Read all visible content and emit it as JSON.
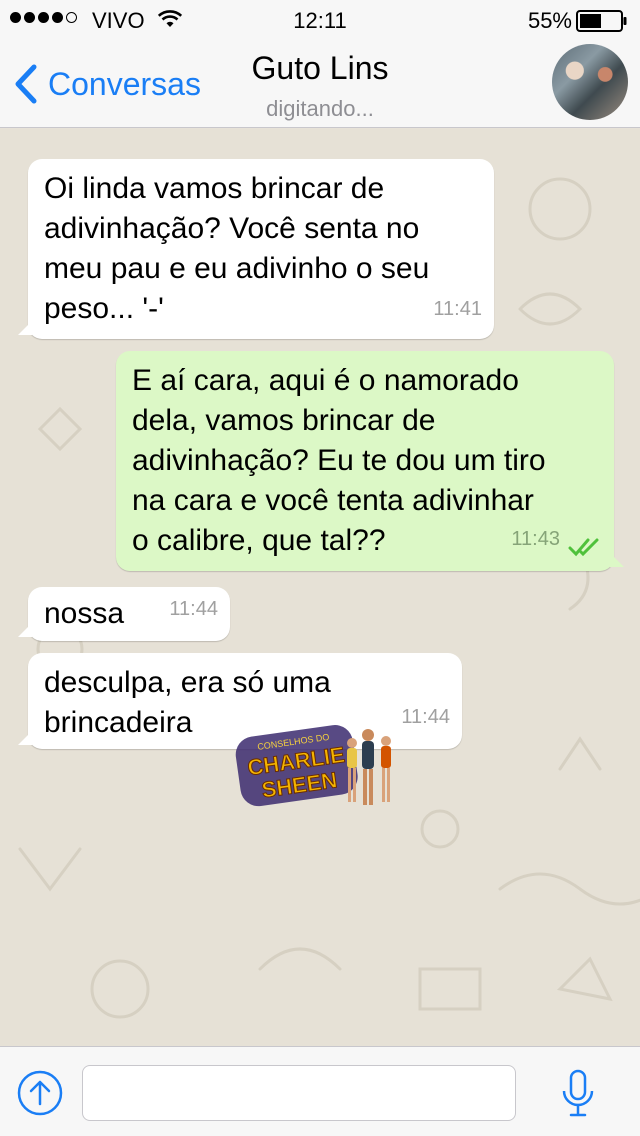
{
  "status_bar": {
    "carrier": "VIVO",
    "time": "12:11",
    "battery": "55%",
    "signal_bars_filled": 4,
    "signal_bars_total": 5,
    "battery_level": 0.55
  },
  "nav": {
    "back_label": "Conversas",
    "contact_name": "Guto Lins",
    "contact_status": "digitando..."
  },
  "messages": [
    {
      "direction": "incoming",
      "lines": [
        "Oi linda vamos brincar de",
        "adivinhação? Você senta no",
        "meu pau e eu adivinho o seu",
        "peso... '-'"
      ],
      "time": "11:41"
    },
    {
      "direction": "outgoing",
      "lines": [
        "E aí cara, aqui é o namorado",
        "dela, vamos brincar de",
        "adivinhação? Eu te dou um tiro",
        "na cara e você tenta adivinhar",
        "o calibre, que tal??"
      ],
      "time": "11:43",
      "read": true
    },
    {
      "direction": "incoming",
      "lines": [
        "nossa"
      ],
      "time": "11:44"
    },
    {
      "direction": "incoming",
      "lines": [
        "desculpa, era só uma",
        "brincadeira"
      ],
      "time": "11:44"
    }
  ],
  "sticker": {
    "caption_top": "CONSELHOS DO",
    "caption_main_1": "CHARLIE",
    "caption_main_2": "SHEEN"
  },
  "input": {
    "placeholder": "",
    "value": ""
  },
  "icons": {
    "back": "chevron-left-icon",
    "attach": "upload-arrow-icon",
    "mic": "microphone-icon",
    "wifi": "wifi-icon",
    "battery": "battery-icon",
    "read_receipt": "double-check-icon"
  },
  "colors": {
    "accent": "#1a7ef5",
    "outgoing_bubble": "#dcf8c6",
    "incoming_bubble": "#ffffff",
    "read_ticks": "#4fc13b",
    "wallpaper": "#e6e1d6"
  }
}
